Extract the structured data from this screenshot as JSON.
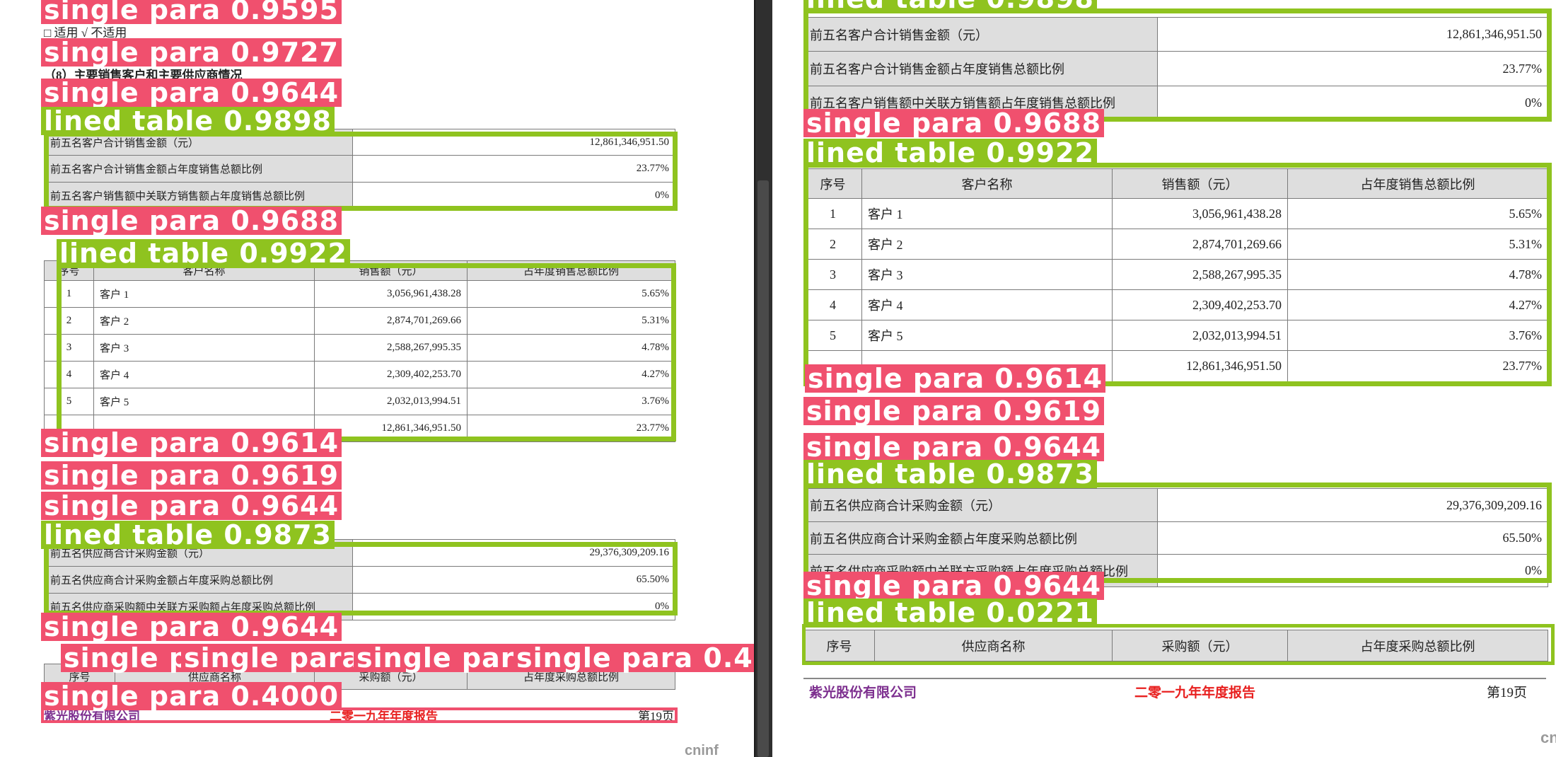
{
  "labels": {
    "sp_9595": "single para 0.9595",
    "sp_9727": "single para 0.9727",
    "sp_9644": "single para 0.9644",
    "lt_9898": "lined table 0.9898",
    "sp_9688": "single para 0.9688",
    "lt_9922": "lined table 0.9922",
    "sp_9614": "single para 0.9614",
    "sp_9619": "single para 0.9619",
    "lt_9873": "lined table 0.9873",
    "sp_4000": "single para 0.4000",
    "lt_0221": "lined table 0.0221",
    "sp_frag1": "single p",
    "sp_frag2": "single para",
    "sp_frag3": "single par",
    "sp_frag4": "single para 0.4"
  },
  "page": {
    "applicable_line": "□ 适用  √ 不适用",
    "section8_heading": "（8）主要销售客户和主要供应商情况"
  },
  "sales_summary": {
    "rows": [
      {
        "label": "前五名客户合计销售金额（元）",
        "value": "12,861,346,951.50"
      },
      {
        "label": "前五名客户合计销售金额占年度销售总额比例",
        "value": "23.77%"
      },
      {
        "label": "前五名客户销售额中关联方销售额占年度销售总额比例",
        "value": "0%"
      }
    ]
  },
  "customers": {
    "headers": [
      "序号",
      "客户名称",
      "销售额（元）",
      "占年度销售总额比例"
    ],
    "rows": [
      {
        "no": "1",
        "name": "客户 1",
        "amount": "3,056,961,438.28",
        "pct": "5.65%"
      },
      {
        "no": "2",
        "name": "客户 2",
        "amount": "2,874,701,269.66",
        "pct": "5.31%"
      },
      {
        "no": "3",
        "name": "客户 3",
        "amount": "2,588,267,995.35",
        "pct": "4.78%"
      },
      {
        "no": "4",
        "name": "客户 4",
        "amount": "2,309,402,253.70",
        "pct": "4.27%"
      },
      {
        "no": "5",
        "name": "客户 5",
        "amount": "2,032,013,994.51",
        "pct": "3.76%"
      }
    ],
    "total": {
      "amount": "12,861,346,951.50",
      "pct": "23.77%"
    }
  },
  "suppliers_summary": {
    "rows": [
      {
        "label": "前五名供应商合计采购金额（元）",
        "value": "29,376,309,209.16"
      },
      {
        "label": "前五名供应商合计采购金额占年度采购总额比例",
        "value": "65.50%"
      },
      {
        "label": "前五名供应商采购额中关联方采购额占年度采购总额比例",
        "value": "0%"
      }
    ]
  },
  "suppliers": {
    "headers": [
      "序号",
      "供应商名称",
      "采购额（元）",
      "占年度采购总额比例"
    ]
  },
  "footer": {
    "company": "紫光股份有限公司",
    "report_title": "二零一九年年度报告",
    "page": "第19页"
  },
  "watermark": "cninf"
}
